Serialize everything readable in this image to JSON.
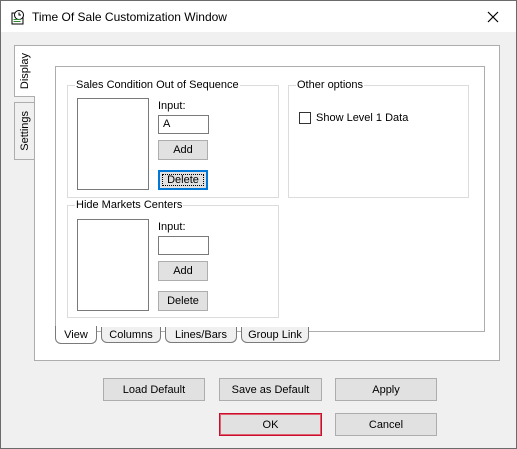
{
  "window": {
    "title": "Time Of Sale Customization Window",
    "close_glyph": "✕"
  },
  "side_tabs": [
    {
      "label": "Display",
      "active": true
    },
    {
      "label": "Settings",
      "active": false
    }
  ],
  "sales_condition": {
    "title": "Sales Condition Out of Sequence",
    "input_label": "Input:",
    "input_value": "A",
    "add_label": "Add",
    "delete_label": "Delete"
  },
  "other_options": {
    "title": "Other options",
    "show_level1_label": "Show Level 1 Data",
    "show_level1_checked": false
  },
  "hide_markets": {
    "title": "Hide Markets Centers",
    "input_label": "Input:",
    "input_value": "",
    "add_label": "Add",
    "delete_label": "Delete"
  },
  "bottom_tabs": [
    {
      "label": "View",
      "active": true
    },
    {
      "label": "Columns",
      "active": false
    },
    {
      "label": "Lines/Bars",
      "active": false
    },
    {
      "label": "Group Link",
      "active": false
    }
  ],
  "footer": {
    "load_default": "Load Default",
    "save_as_default": "Save as Default",
    "apply": "Apply",
    "ok": "OK",
    "cancel": "Cancel"
  },
  "colors": {
    "focus_blue": "#0078d7",
    "default_button_border": "#c8102e"
  }
}
